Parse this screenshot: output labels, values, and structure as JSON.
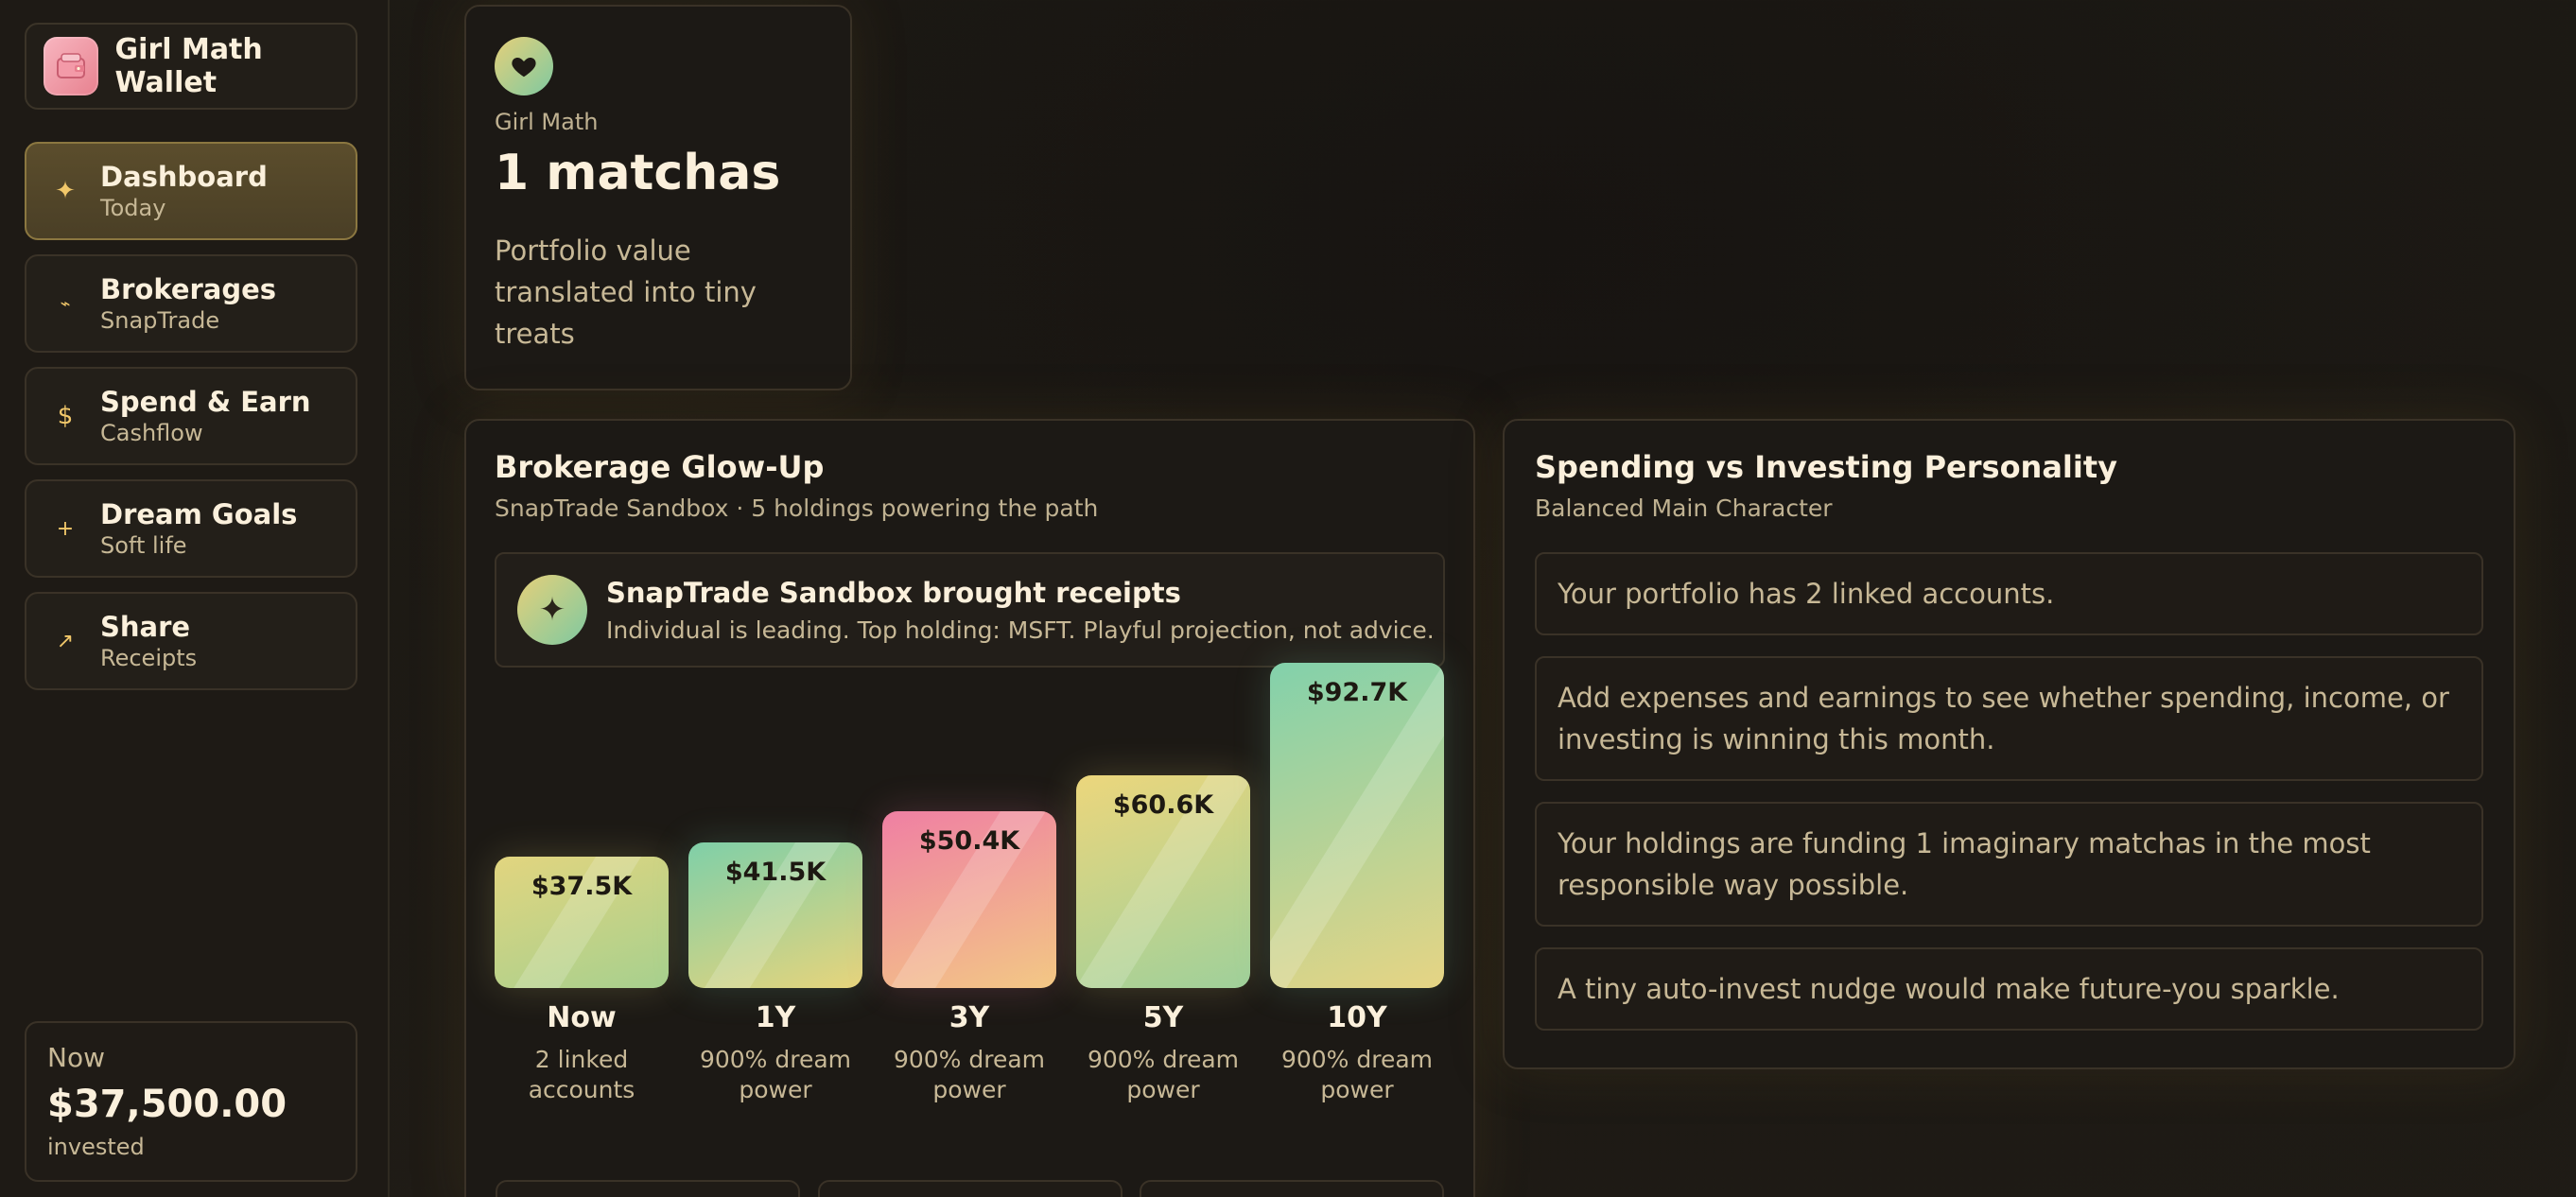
{
  "app": {
    "name": "Girl Math Wallet"
  },
  "nav": [
    {
      "title": "Dashboard",
      "sub": "Today",
      "icon": "sparkle-icon"
    },
    {
      "title": "Brokerages",
      "sub": "SnapTrade",
      "icon": "link-icon"
    },
    {
      "title": "Spend & Earn",
      "sub": "Cashflow",
      "icon": "dollar-icon"
    },
    {
      "title": "Dream Goals",
      "sub": "Soft life",
      "icon": "plus-icon"
    },
    {
      "title": "Share",
      "sub": "Receipts",
      "icon": "arrow-icon"
    }
  ],
  "invested": {
    "label": "Now",
    "value": "$37,500.00",
    "sub": "invested"
  },
  "girl_math": {
    "label": "Girl Math",
    "value": "1 matchas",
    "desc": "Portfolio value translated into tiny treats"
  },
  "glow": {
    "title": "Brokerage Glow-Up",
    "sub": "SnapTrade Sandbox · 5 holdings powering the path",
    "receipt_title": "SnapTrade Sandbox brought receipts",
    "receipt_sub": "Individual is leading. Top holding: MSFT. Playful projection, not advice."
  },
  "chart_data": {
    "type": "bar",
    "categories": [
      "Now",
      "1Y",
      "3Y",
      "5Y",
      "10Y"
    ],
    "values": [
      37.5,
      41.5,
      50.4,
      60.6,
      92.7
    ],
    "value_labels": [
      "$37.5K",
      "$41.5K",
      "$50.4K",
      "$60.6K",
      "$92.7K"
    ],
    "notes": [
      "2 linked accounts",
      "900% dream power",
      "900% dream power",
      "900% dream power",
      "900% dream power"
    ],
    "colors": [
      "#e2d57f",
      "#7fcfa8",
      "#ef7fa3",
      "#ecd67c",
      "#82d1ab"
    ],
    "gradient_end": [
      "#a7d08e",
      "#e6d47c",
      "#f3c885",
      "#9fd09a",
      "#e6d484"
    ],
    "ylim": [
      0,
      92.7
    ]
  },
  "personality": {
    "title": "Spending vs Investing Personality",
    "sub": "Balanced Main Character",
    "items": [
      "Your portfolio has 2 linked accounts.",
      "Add expenses and earnings to see whether spending, income, or investing is winning this month.",
      "Your holdings are funding 1 imaginary matchas in the most responsible way possible.",
      "A tiny auto-invest nudge would make future-you sparkle."
    ]
  }
}
